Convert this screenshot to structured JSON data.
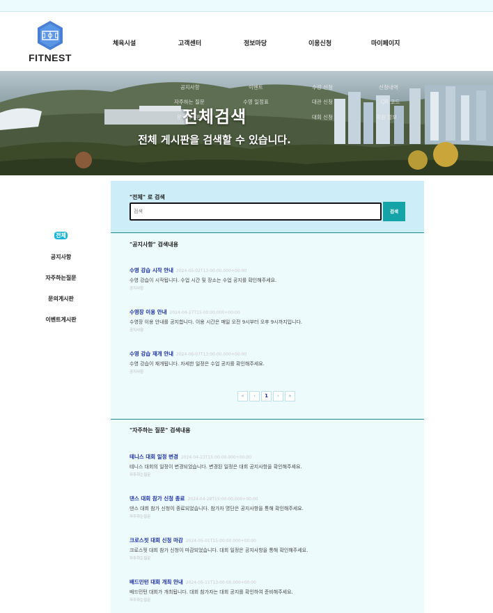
{
  "brand": {
    "name": "FITNEST"
  },
  "nav": [
    "체육시설",
    "고객센터",
    "정보마당",
    "이용신청",
    "마이페이지"
  ],
  "submenu": [
    "공지사항",
    "이벤트",
    "수강 신청",
    "신청내역",
    "자주하는 질문",
    "수영 일정표",
    "대관 신청",
    "QR 코드",
    "문의게시판",
    "대회 신청",
    "회원 정보"
  ],
  "banner": {
    "title": "전체검색",
    "subtitle": "전체 게시판을 검색할 수 있습니다."
  },
  "sidebar": {
    "items": [
      "전체",
      "공지사항",
      "자주하는질문",
      "문의게시판",
      "이벤트게시판"
    ]
  },
  "search": {
    "label": "\"전체\" 로 검색",
    "placeholder": "검색",
    "button": "검색"
  },
  "sections": [
    {
      "title": "\"공지사항\" 검색내용",
      "posts": [
        {
          "title": "수영 강습 시작 안내",
          "date": "2024-05-02T13:00:00.000+00:00",
          "body": "수영 강습이 시작됩니다. 수업 시간 및 장소는 수업 공지를 확인해주세요.",
          "category": "공지사항"
        },
        {
          "title": "수영장 이용 안내",
          "date": "2024-04-27T15:00:00.000+00:00",
          "body": "수영장 이용 안내를 공지합니다. 이용 시간은 매일 오전 9시부터 오후 9시까지입니다.",
          "category": "공지사항"
        },
        {
          "title": "수영 강습 재개 안내",
          "date": "2024-06-07T13:00:00.000+00:00",
          "body": "수영 강습이 재개됩니다. 자세한 일정은 수업 공지를 확인해주세요.",
          "category": "공지사항"
        }
      ],
      "pagination": [
        "«",
        "‹",
        "1",
        "›",
        "»"
      ]
    },
    {
      "title": "\"자주하는 질문\" 검색내용",
      "posts": [
        {
          "title": "테니스 대회 일정 변경",
          "date": "2024-04-23T15:00:00.000+00:00",
          "body": "테니스 대회의 일정이 변경되었습니다. 변경된 일정은 대회 공지사항을 확인해주세요.",
          "category": "자주하는질문"
        },
        {
          "title": "댄스 대회 참가 신청 종료",
          "date": "2024-04-28T15:00:00.000+00:00",
          "body": "댄스 대회 참가 신청이 종료되었습니다. 참가자 명단은 공지사항을 통해 확인해주세요.",
          "category": "자주하는질문"
        },
        {
          "title": "크로스핏 대회 신청 마감",
          "date": "2024-05-01T15:00:00.000+00:00",
          "body": "크로스핏 대회 참가 신청이 마감되었습니다. 대회 일정은 공지사항을 통해 확인해주세요.",
          "category": "자주하는질문"
        },
        {
          "title": "배드민턴 대회 개최 안내",
          "date": "2024-05-11T13:00:00.000+00:00",
          "body": "배드민턴 대회가 개최됩니다. 대회 참가자는 대회 공지를 확인하여 준비해주세요.",
          "category": "자주하는질문"
        }
      ]
    }
  ]
}
